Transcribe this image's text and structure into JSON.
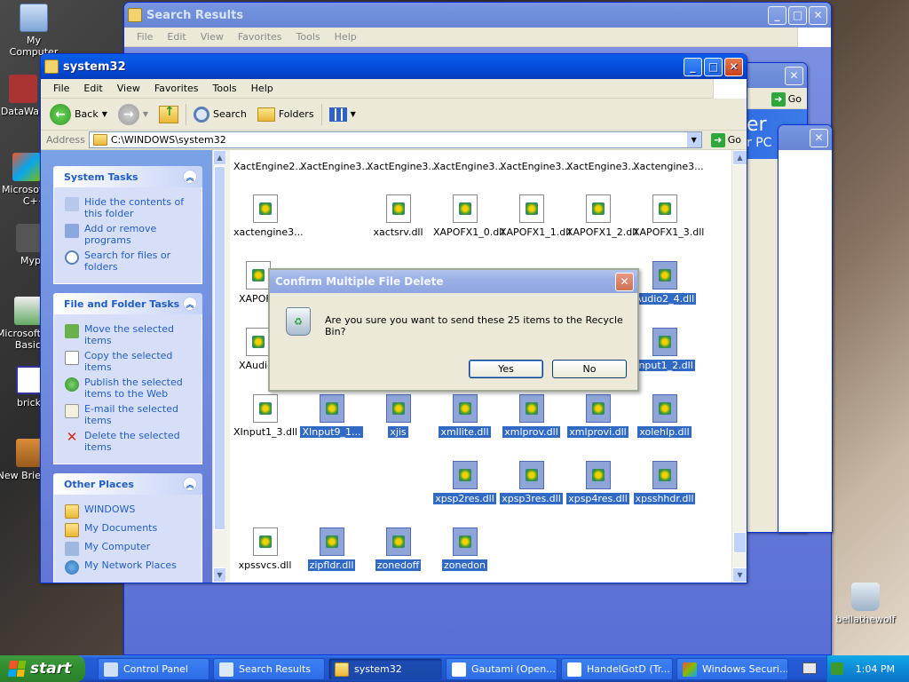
{
  "desktop": {
    "icons": [
      {
        "label": "My Computer"
      },
      {
        "label": "DataWa"
      },
      {
        "label": "Microsoft C++"
      },
      {
        "label": "Myp"
      },
      {
        "label": "Microsoft Basic"
      },
      {
        "label": "brick"
      },
      {
        "label": "New Brie"
      },
      {
        "label": "bellathewolf"
      }
    ]
  },
  "search_window": {
    "title": "Search Results",
    "menu": [
      "File",
      "Edit",
      "View",
      "Favorites",
      "Tools",
      "Help"
    ]
  },
  "bg_window": {
    "go_label": "Go",
    "banner_text": "er",
    "banner_sub": "r PC"
  },
  "explorer": {
    "title": "system32",
    "menu": [
      "File",
      "Edit",
      "View",
      "Favorites",
      "Tools",
      "Help"
    ],
    "toolbar": {
      "back": "Back",
      "search": "Search",
      "folders": "Folders"
    },
    "address": {
      "label": "Address",
      "value": "C:\\WINDOWS\\system32",
      "go": "Go"
    },
    "system_tasks": {
      "title": "System Tasks",
      "items": [
        "Hide the contents of this folder",
        "Add or remove programs",
        "Search for files or folders"
      ]
    },
    "file_tasks": {
      "title": "File and Folder Tasks",
      "items": [
        "Move the selected items",
        "Copy the selected items",
        "Publish the selected items to the Web",
        "E-mail the selected items",
        "Delete the selected items"
      ]
    },
    "other_places": {
      "title": "Other Places",
      "items": [
        "WINDOWS",
        "My Documents",
        "My Computer",
        "My Network Places"
      ]
    },
    "files": [
      {
        "name": "XactEngine2...",
        "selected": false
      },
      {
        "name": "XactEngine3...",
        "selected": false
      },
      {
        "name": "XactEngine3...",
        "selected": false
      },
      {
        "name": "XactEngine3...",
        "selected": false
      },
      {
        "name": "XactEngine3...",
        "selected": false
      },
      {
        "name": "XactEngine3...",
        "selected": false
      },
      {
        "name": "Xactengine3...",
        "selected": false
      },
      {
        "name": "xactengine3...",
        "selected": false
      },
      {
        "name": "xactsrv.dll",
        "selected": false
      },
      {
        "name": "XAPOFX1_0.dll",
        "selected": false
      },
      {
        "name": "XAPOFX1_1.dll",
        "selected": false
      },
      {
        "name": "XAPOFX1_2.dll",
        "selected": false
      },
      {
        "name": "XAPOFX1_3.dll",
        "selected": false
      },
      {
        "name": "XAPOFX",
        "selected": false
      },
      {
        "name": "Audio2_4.dll",
        "selected": true
      },
      {
        "name": "XAudio2",
        "selected": false
      },
      {
        "name": "Input1_2.dll",
        "selected": true
      },
      {
        "name": "XInput1_3.dll",
        "selected": false
      },
      {
        "name": "XInput9_1...",
        "selected": true
      },
      {
        "name": "xjis",
        "selected": true
      },
      {
        "name": "xmllite.dll",
        "selected": true
      },
      {
        "name": "xmlprov.dll",
        "selected": true
      },
      {
        "name": "xmlprovi.dll",
        "selected": true
      },
      {
        "name": "xolehlp.dll",
        "selected": true
      },
      {
        "name": "xpsp2res.dll",
        "selected": true
      },
      {
        "name": "xpsp3res.dll",
        "selected": true
      },
      {
        "name": "xpsp4res.dll",
        "selected": true
      },
      {
        "name": "xpsshhdr.dll",
        "selected": true
      },
      {
        "name": "xpssvcs.dll",
        "selected": false
      },
      {
        "name": "zipfldr.dll",
        "selected": true
      },
      {
        "name": "zonedoff",
        "selected": true
      },
      {
        "name": "zonedon",
        "selected": true
      }
    ]
  },
  "dialog": {
    "title": "Confirm Multiple File Delete",
    "message": "Are you sure you want to send these 25 items to the Recycle Bin?",
    "yes": "Yes",
    "no": "No"
  },
  "taskbar": {
    "start": "start",
    "tasks": [
      {
        "label": "Control Panel",
        "active": false
      },
      {
        "label": "Search Results",
        "active": false
      },
      {
        "label": "system32",
        "active": true
      },
      {
        "label": "Gautami (Open...",
        "active": false
      },
      {
        "label": "HandelGotD (Tr...",
        "active": false
      },
      {
        "label": "Windows Securi...",
        "active": false
      }
    ],
    "clock": "1:04 PM"
  },
  "colors": {
    "xp_blue": "#0554e3",
    "selection": "#316ac5",
    "task_link": "#215dc6",
    "start_green": "#2f8d2f"
  }
}
